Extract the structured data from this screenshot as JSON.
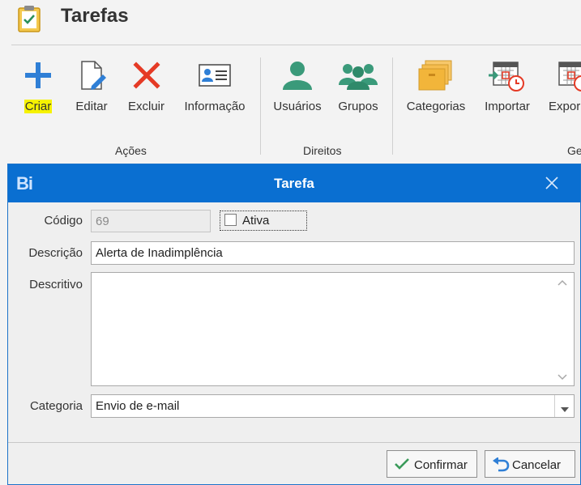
{
  "app": {
    "title": "Tarefas"
  },
  "ribbon": {
    "groups": [
      {
        "label": "Ações"
      },
      {
        "label": "Direitos"
      },
      {
        "label": "Ge"
      }
    ],
    "buttons": {
      "criar": "Criar",
      "editar": "Editar",
      "excluir": "Excluir",
      "informacao": "Informação",
      "usuarios": "Usuários",
      "grupos": "Grupos",
      "categorias": "Categorias",
      "importar": "Importar",
      "exportar": "Expor"
    }
  },
  "dialog": {
    "logo": "Bi",
    "title": "Tarefa",
    "fields": {
      "codigo_label": "Código",
      "codigo_value": "69",
      "ativa_label": "Ativa",
      "ativa_checked": false,
      "descricao_label": "Descrição",
      "descricao_value": "Alerta de Inadimplência",
      "descritivo_label": "Descritivo",
      "descritivo_value": "",
      "categoria_label": "Categoria",
      "categoria_value": "Envio de e-mail"
    },
    "buttons": {
      "confirmar": "Confirmar",
      "cancelar": "Cancelar"
    }
  },
  "colors": {
    "accent_blue": "#0a6fd1",
    "highlight_yellow": "#f6f200",
    "icon_blue": "#2f7fd6",
    "icon_red": "#e53a25",
    "icon_green": "#3a9a7a",
    "icon_folder": "#f2b53a"
  }
}
